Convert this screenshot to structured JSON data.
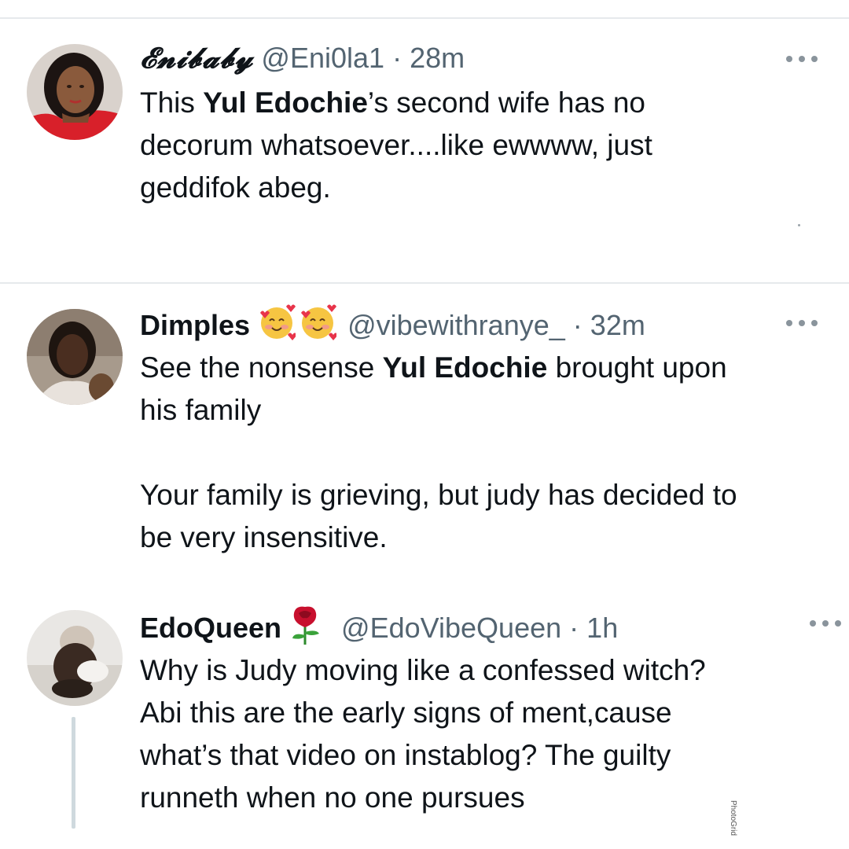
{
  "tweets": [
    {
      "name": "𝓔𝓷𝓲𝓫𝓪𝓫𝔂",
      "handle": "@Eni0la1",
      "dot": "·",
      "time": "28m",
      "body_pre": "This ",
      "body_bold": "Yul Edochie",
      "body_post": "’s second wife has no\ndecorum whatsoever....like ewwww, just\ngeddifok abeg."
    },
    {
      "name": "Dimples",
      "emojis": [
        "smiling-face-with-hearts-icon",
        "smiling-face-with-hearts-icon"
      ],
      "handle": "@vibewithranye_",
      "dot": "·",
      "time": "32m",
      "body_pre": "See the nonsense ",
      "body_bold": "Yul Edochie",
      "body_post": " brought upon\nhis family\n\nYour family is grieving, but judy has decided to\nbe very insensitive."
    },
    {
      "name": "EdoQueen",
      "emojis": [
        "rose-icon"
      ],
      "handle": "@EdoVibeQueen",
      "dot": "·",
      "time": "1h",
      "body": "Why is Judy moving like a confessed witch?\nAbi this are the early signs of ment,cause\nwhat’s that video on instablog? The guilty\nrunneth when no one pursues"
    }
  ],
  "watermark": "PhotoGrid",
  "colors": {
    "text": "#0f1419",
    "secondary": "#536471",
    "divider": "#e6e9ec",
    "thread_line": "#cfd9de"
  }
}
